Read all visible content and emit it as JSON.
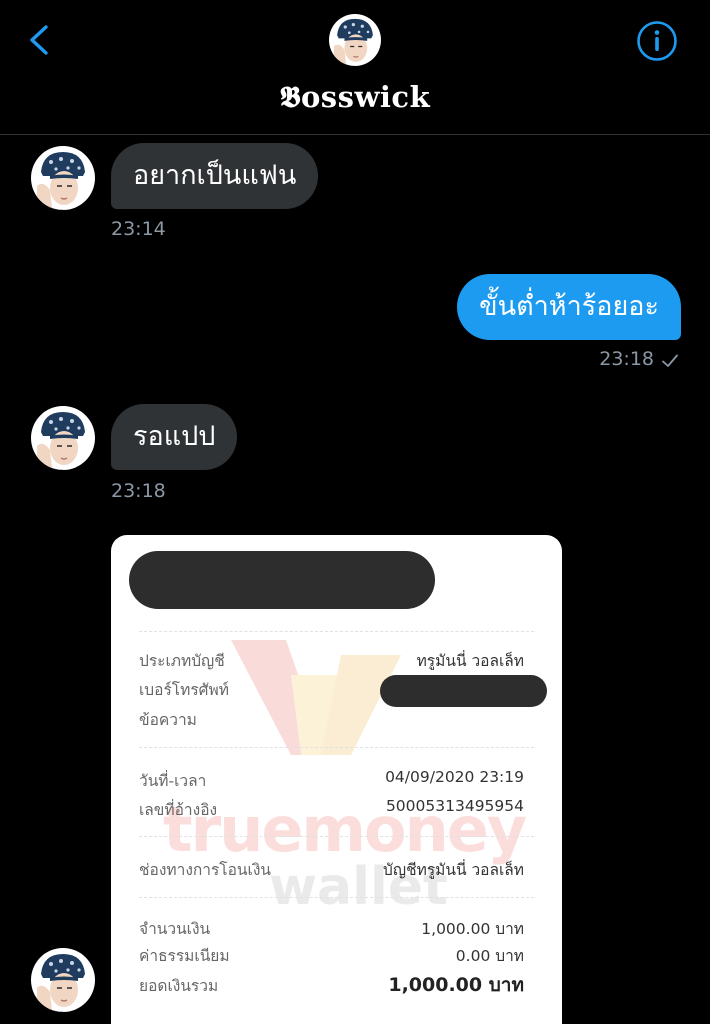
{
  "header": {
    "name": "𝕭osswick",
    "back_icon": "chevron-left-icon",
    "info_icon": "info-circle-icon",
    "accent": "#1d9bf0"
  },
  "messages": [
    {
      "direction": "incoming",
      "text": "อยากเป็นแฟน",
      "time": "23:14"
    },
    {
      "direction": "outgoing",
      "text": "ขั้นต่ำห้าร้อยอะ",
      "time": "23:18",
      "status_icon": "check-icon"
    },
    {
      "direction": "incoming",
      "text": "รอแปป",
      "time": "23:18"
    }
  ],
  "receipt": {
    "watermark": {
      "brand_top": "truemoney",
      "brand_bottom": "wallet"
    },
    "rows": [
      {
        "label": "ประเภทบัญชี",
        "value": "ทรูมันนี่ วอลเล็ท"
      },
      {
        "label": "เบอร์โทรศัพท์",
        "value": ""
      },
      {
        "label": "ข้อความ",
        "value": ""
      },
      {
        "label": "วันที่-เวลา",
        "value": "04/09/2020 23:19"
      },
      {
        "label": "เลขที่อ้างอิง",
        "value": "50005313495954"
      },
      {
        "label": "ช่องทางการโอนเงิน",
        "value": "บัญชีทรูมันนี่ วอลเล็ท"
      },
      {
        "label": "จำนวนเงิน",
        "value": "1,000.00 บาท"
      },
      {
        "label": "ค่าธรรมเนียม",
        "value": "0.00 บาท"
      },
      {
        "label": "ยอดเงินรวม",
        "value": "1,000.00 บาท"
      }
    ]
  },
  "colors": {
    "background": "#000000",
    "incoming_bubble": "#2f3336",
    "outgoing_bubble": "#1d9bf0",
    "timestamp": "#8b98a5"
  }
}
